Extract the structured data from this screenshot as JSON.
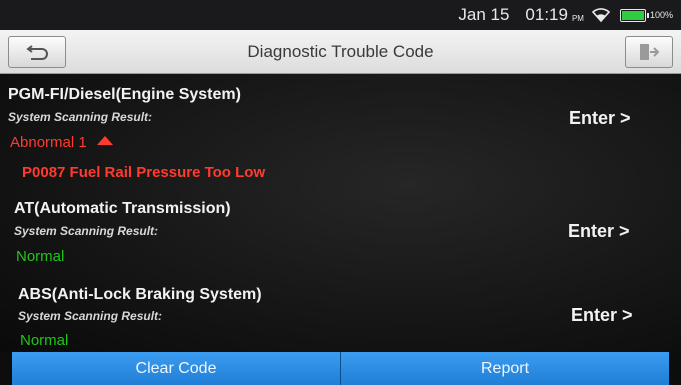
{
  "status_bar": {
    "date": "Jan 15",
    "time": "01:19",
    "ampm": "PM",
    "battery_pct": "100%",
    "battery_level": 1.0
  },
  "header": {
    "title": "Diagnostic Trouble Code",
    "back_icon": "back-arrow-icon",
    "exit_icon": "exit-icon"
  },
  "systems": [
    {
      "name": "PGM-FI/Diesel(Engine System)",
      "scan_label": "System Scanning Result:",
      "result": "Abnormal 1",
      "status": "abnormal",
      "enter_label": "Enter >",
      "codes": [
        "P0087 Fuel Rail Pressure Too Low"
      ]
    },
    {
      "name": "AT(Automatic Transmission)",
      "scan_label": "System Scanning Result:",
      "result": "Normal",
      "status": "normal",
      "enter_label": "Enter >"
    },
    {
      "name": "ABS(Anti-Lock Braking System)",
      "scan_label": "System Scanning Result:",
      "result": "Normal",
      "status": "normal",
      "enter_label": "Enter >"
    }
  ],
  "footer": {
    "clear_label": "Clear Code",
    "report_label": "Report"
  },
  "colors": {
    "abnormal": "#ff3b30",
    "normal": "#22c41a",
    "button": "#2a8ae6"
  }
}
